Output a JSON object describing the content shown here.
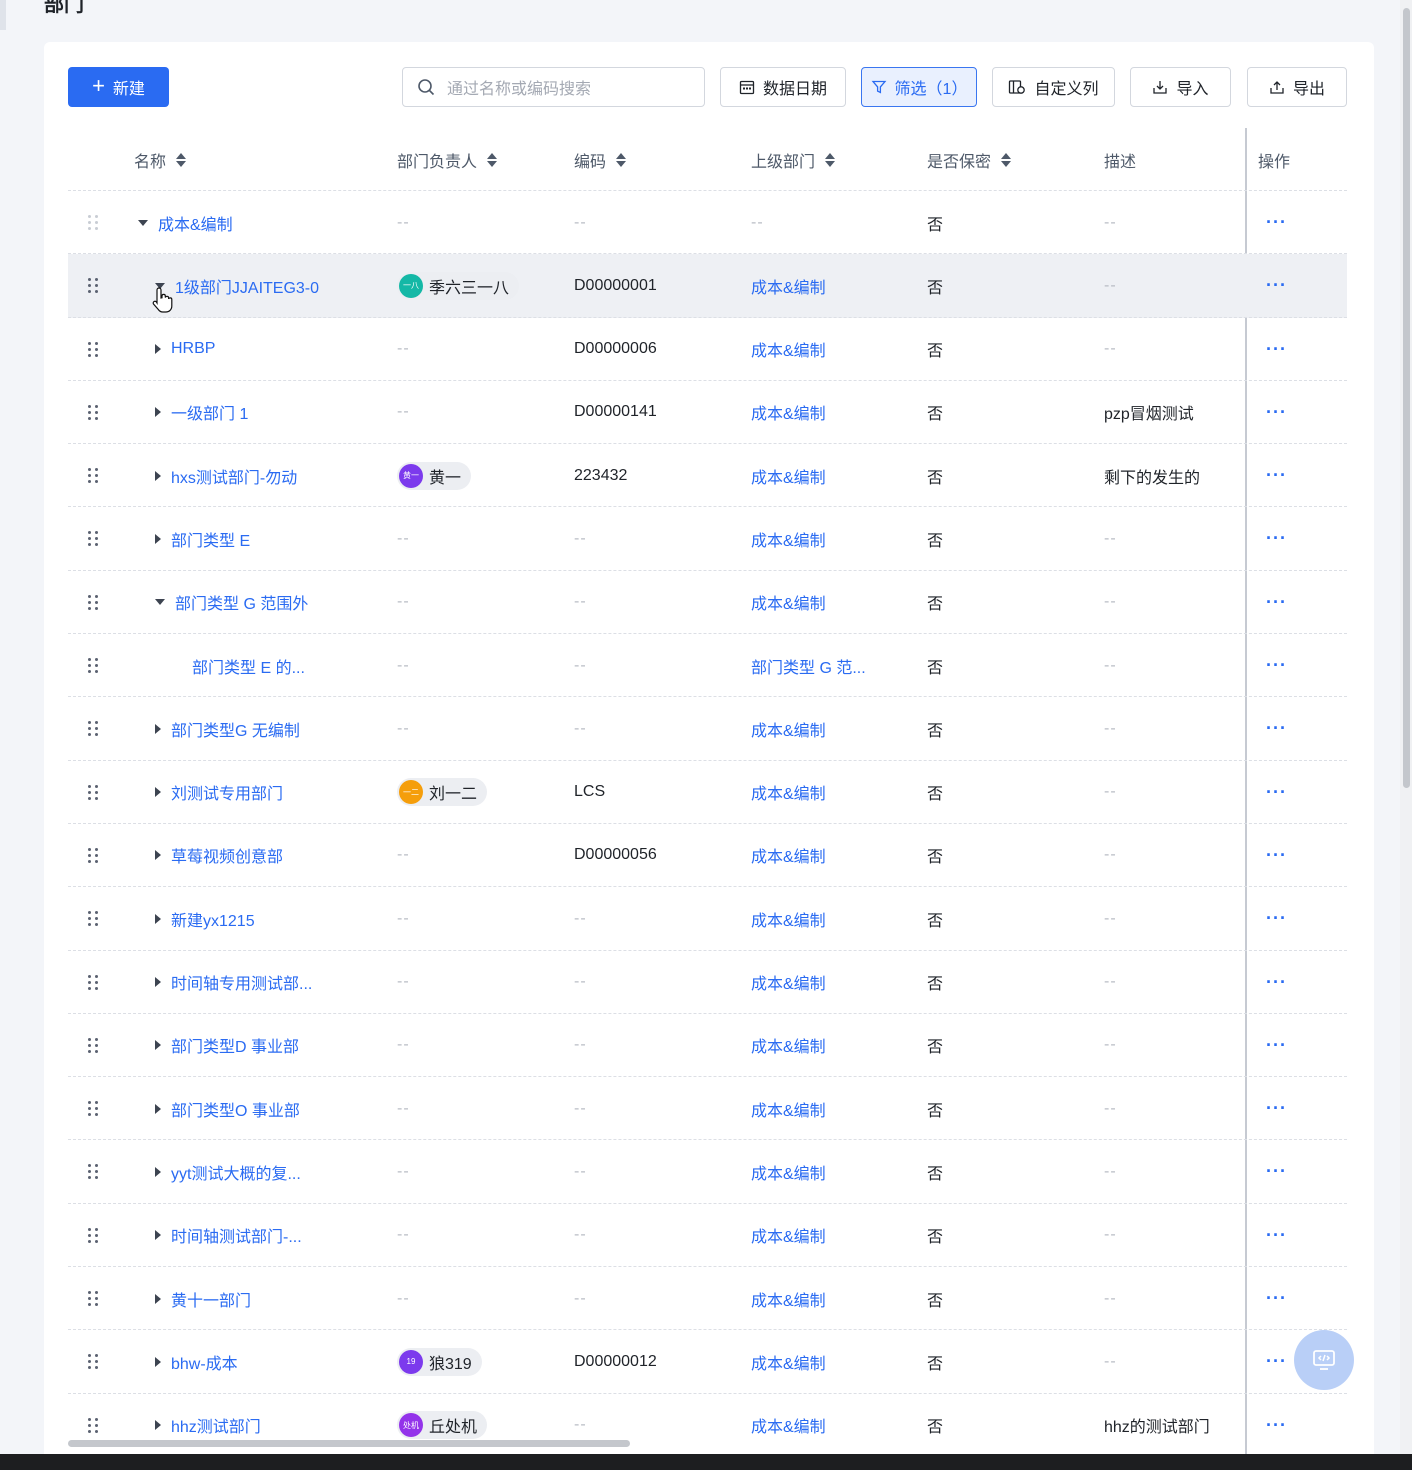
{
  "page": {
    "title": "部门"
  },
  "toolbar": {
    "new_label": "新建",
    "search_placeholder": "通过名称或编码搜索",
    "date_label": "数据日期",
    "filter_label": "筛选（1）",
    "custom_columns_label": "自定义列",
    "import_label": "导入",
    "export_label": "导出"
  },
  "table": {
    "headers": {
      "name": "名称",
      "owner": "部门负责人",
      "code": "编码",
      "parent": "上级部门",
      "confidential": "是否保密",
      "description": "描述",
      "action": "操作"
    },
    "empty": "--",
    "rows": [
      {
        "name": "成本&编制",
        "owner": "--",
        "code": "--",
        "parent": "--",
        "confidential": "否",
        "description": "--",
        "action": "···"
      },
      {
        "name": "1级部门JJAITEG3-0",
        "owner": "季六三一八",
        "owner_avatar": "一八",
        "owner_avatar_color": "#14b8a6",
        "code": "D00000001",
        "parent": "成本&编制",
        "confidential": "否",
        "description": "--",
        "action": "···"
      },
      {
        "name": "HRBP",
        "owner": "--",
        "code": "D00000006",
        "parent": "成本&编制",
        "confidential": "否",
        "description": "--",
        "action": "···"
      },
      {
        "name": "一级部门 1",
        "owner": "--",
        "code": "D00000141",
        "parent": "成本&编制",
        "confidential": "否",
        "description": "pzp冒烟测试",
        "action": "···"
      },
      {
        "name": "hxs测试部门-勿动",
        "owner": "黄一",
        "owner_avatar": "黄一",
        "owner_avatar_color": "#7c3aed",
        "code": "223432",
        "parent": "成本&编制",
        "confidential": "否",
        "description": "剩下的发生的",
        "action": "···"
      },
      {
        "name": "部门类型 E",
        "owner": "--",
        "code": "--",
        "parent": "成本&编制",
        "confidential": "否",
        "description": "--",
        "action": "···"
      },
      {
        "name": "部门类型 G 范围外",
        "owner": "--",
        "code": "--",
        "parent": "成本&编制",
        "confidential": "否",
        "description": "--",
        "action": "···"
      },
      {
        "name": "部门类型 E 的...",
        "owner": "--",
        "code": "--",
        "parent": "部门类型 G 范...",
        "confidential": "否",
        "description": "--",
        "action": "···"
      },
      {
        "name": "部门类型G 无编制",
        "owner": "--",
        "code": "--",
        "parent": "成本&编制",
        "confidential": "否",
        "description": "--",
        "action": "···"
      },
      {
        "name": "刘测试专用部门",
        "owner": "刘一二",
        "owner_avatar": "一二",
        "owner_avatar_color": "#f59e0b",
        "code": "LCS",
        "parent": "成本&编制",
        "confidential": "否",
        "description": "--",
        "action": "···"
      },
      {
        "name": "草莓视频创意部",
        "owner": "--",
        "code": "D00000056",
        "parent": "成本&编制",
        "confidential": "否",
        "description": "--",
        "action": "···"
      },
      {
        "name": "新建yx1215",
        "owner": "--",
        "code": "--",
        "parent": "成本&编制",
        "confidential": "否",
        "description": "--",
        "action": "···"
      },
      {
        "name": "时间轴专用测试部...",
        "owner": "--",
        "code": "--",
        "parent": "成本&编制",
        "confidential": "否",
        "description": "--",
        "action": "···"
      },
      {
        "name": "部门类型D 事业部",
        "owner": "--",
        "code": "--",
        "parent": "成本&编制",
        "confidential": "否",
        "description": "--",
        "action": "···"
      },
      {
        "name": "部门类型O 事业部",
        "owner": "--",
        "code": "--",
        "parent": "成本&编制",
        "confidential": "否",
        "description": "--",
        "action": "···"
      },
      {
        "name": "yyt测试大概的复...",
        "owner": "--",
        "code": "--",
        "parent": "成本&编制",
        "confidential": "否",
        "description": "--",
        "action": "···"
      },
      {
        "name": "时间轴测试部门-...",
        "owner": "--",
        "code": "--",
        "parent": "成本&编制",
        "confidential": "否",
        "description": "--",
        "action": "···"
      },
      {
        "name": "黄十一部门",
        "owner": "--",
        "code": "--",
        "parent": "成本&编制",
        "confidential": "否",
        "description": "--",
        "action": "···"
      },
      {
        "name": "bhw-成本",
        "owner": "狼319",
        "owner_avatar": "19",
        "owner_avatar_color": "#7c3aed",
        "code": "D00000012",
        "parent": "成本&编制",
        "confidential": "否",
        "description": "--",
        "action": "···"
      },
      {
        "name": "hhz测试部门",
        "owner": "丘处机",
        "owner_avatar": "处机",
        "owner_avatar_color": "#9333ea",
        "code": "--",
        "parent": "成本&编制",
        "confidential": "否",
        "description": "hhz的测试部门",
        "action": "···"
      }
    ]
  },
  "colors": {
    "primary": "#2a6bf2",
    "filter_active_bg": "#e9f0fe"
  }
}
